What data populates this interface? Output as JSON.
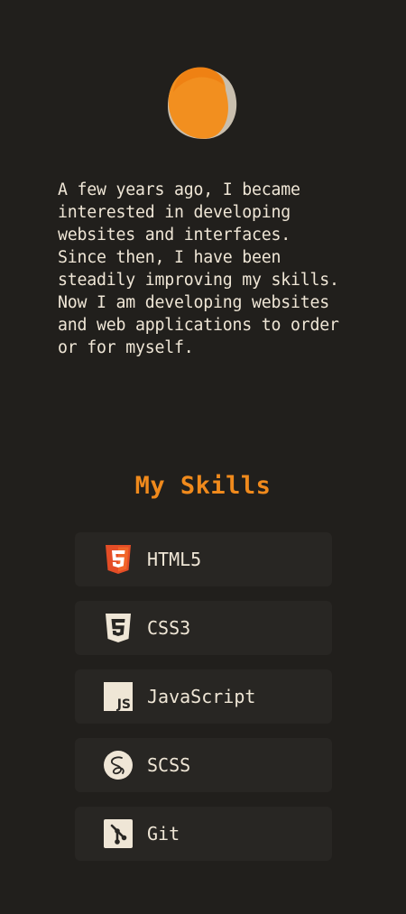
{
  "about": {
    "text": "A few years ago, I became\ninterested in developing\nwebsites and interfaces.\nSince then, I have been\nsteadily improving my skills.\nNow I am developing websites\nand web applications to order\nor for myself."
  },
  "skills": {
    "title": "My Skills",
    "items": [
      {
        "label": "HTML5",
        "icon": "html5-icon"
      },
      {
        "label": "CSS3",
        "icon": "css3-icon"
      },
      {
        "label": "JavaScript",
        "icon": "javascript-icon"
      },
      {
        "label": "SCSS",
        "icon": "sass-icon"
      },
      {
        "label": "Git",
        "icon": "git-icon"
      }
    ]
  },
  "colors": {
    "background": "#211f1c",
    "accent": "#f08a1c",
    "text": "#efe6d6",
    "card": "#282623",
    "html5": "#e44d26"
  }
}
